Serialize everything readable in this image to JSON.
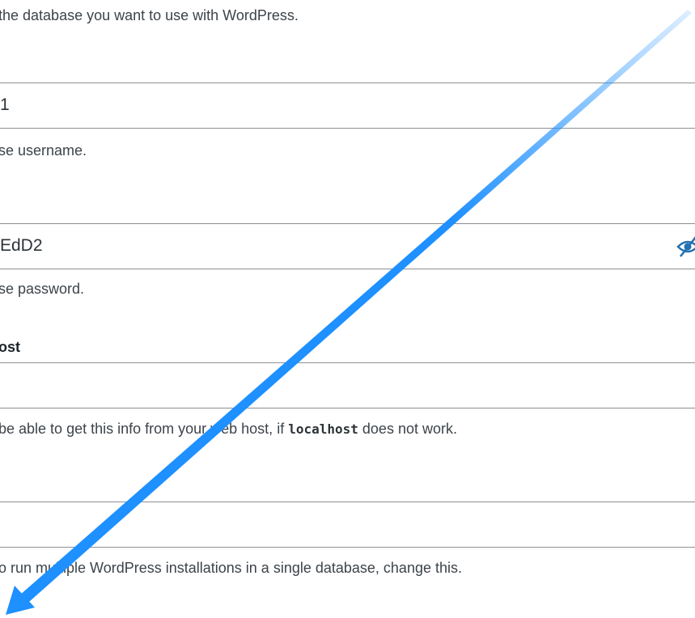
{
  "database_name": {
    "description": "the database you want to use with WordPress."
  },
  "username": {
    "value": "1",
    "description": "se username."
  },
  "password": {
    "value": "EdD2",
    "description": "se password.",
    "toggle_icon": "eye-slash-icon"
  },
  "database_host": {
    "label": "ost",
    "value": "",
    "description_pre": "be able to get this info from your web host, if ",
    "description_code": "localhost",
    "description_post": " does not work."
  },
  "table_prefix": {
    "value": "",
    "description": "o run multiple WordPress installations in a single database, change this."
  },
  "colors": {
    "arrow": "#1e90ff",
    "border": "#8c8f94"
  }
}
